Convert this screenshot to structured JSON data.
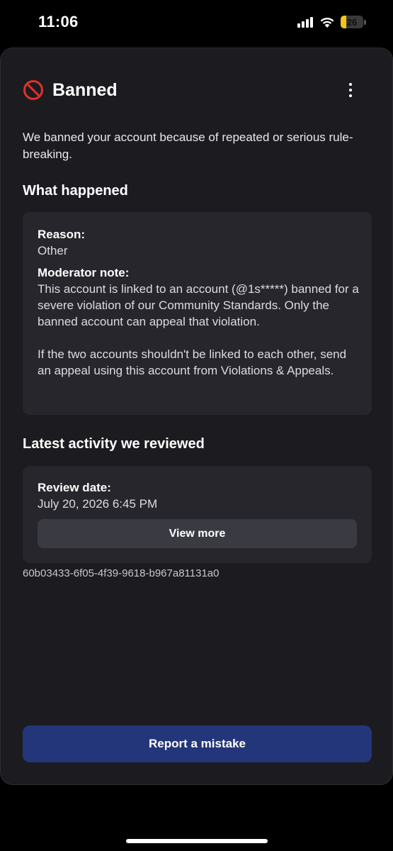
{
  "status_bar": {
    "time": "11:06",
    "battery_level": "26",
    "battery_fraction": 0.26,
    "battery_color": "#f5c518"
  },
  "header": {
    "icon": "ban-icon",
    "title": "Banned",
    "menu_icon": "more-vertical-icon"
  },
  "intro_text": "We banned your account because of repeated or serious rule-breaking.",
  "what_happened": {
    "title": "What happened",
    "reason_label": "Reason:",
    "reason_value": "Other",
    "note_label": "Moderator note:",
    "note_paragraph_1": "This account is linked to an account (@1s*****) banned for a severe violation of our Community Standards. Only the banned account can appeal that violation.",
    "note_paragraph_2": "If the two accounts shouldn't be linked to each other, send an appeal using this account from Violations & Appeals."
  },
  "latest_activity": {
    "title": "Latest activity we reviewed",
    "review_date_label": "Review date:",
    "review_date_value": "July 20, 2026 6:45 PM",
    "view_more_label": "View more"
  },
  "reference_id": "60b03433-6f05-4f39-9618-b967a81131a0",
  "report_button_label": "Report a mistake",
  "colors": {
    "accent_button": "#24367a",
    "ban_icon": "#e0312b",
    "sheet_background": "#1c1c20",
    "card_background": "#26262c"
  }
}
